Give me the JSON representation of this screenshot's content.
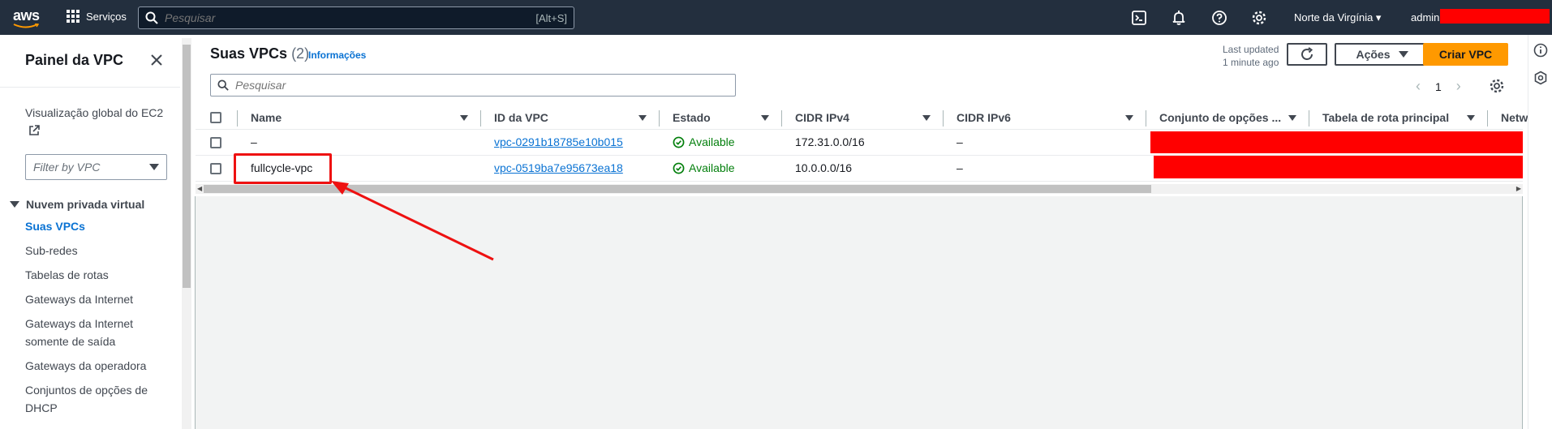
{
  "topbar": {
    "logo_text": "aws",
    "services_label": "Serviços",
    "search_placeholder": "Pesquisar",
    "search_shortcut": "[Alt+S]",
    "region": "Norte da Virgínia ▾",
    "user": "admin"
  },
  "sidebar": {
    "title": "Painel da VPC",
    "global_view": "Visualização global do EC2",
    "filter_placeholder": "Filter by VPC",
    "section": "Nuvem privada virtual",
    "items": [
      {
        "label": "Suas VPCs",
        "active": true
      },
      {
        "label": "Sub-redes"
      },
      {
        "label": "Tabelas de rotas"
      },
      {
        "label": "Gateways da Internet"
      },
      {
        "label": "Gateways da Internet somente de saída"
      },
      {
        "label": "Gateways da operadora"
      },
      {
        "label": "Conjuntos de opções de DHCP"
      }
    ]
  },
  "header": {
    "title": "Suas VPCs",
    "count": "(2)",
    "info": "Informações",
    "last_updated_line1": "Last updated",
    "last_updated_line2": "1 minute ago",
    "actions_label": "Ações",
    "create_label": "Criar VPC"
  },
  "table": {
    "search_placeholder": "Pesquisar",
    "page": "1",
    "columns": [
      "Name",
      "ID da VPC",
      "Estado",
      "CIDR IPv4",
      "CIDR IPv6",
      "Conjunto de opções ...",
      "Tabela de rota principal",
      "Netw"
    ],
    "rows": [
      {
        "name": "–",
        "vpc_id": "vpc-0291b18785e10b015",
        "state": "Available",
        "cidr4": "172.31.0.0/16",
        "cidr6": "–"
      },
      {
        "name": "fullcycle-vpc",
        "vpc_id": "vpc-0519ba7e95673ea18",
        "state": "Available",
        "cidr4": "10.0.0.0/16",
        "cidr6": "–"
      }
    ]
  },
  "colors": {
    "topbar": "#232f3e",
    "link": "#0972d3",
    "primary_button": "#ff9900",
    "status_ok": "#037f0c",
    "annotation": "#ee1111",
    "redaction": "#ff0000"
  },
  "icons": [
    "aws-logo",
    "grid-icon",
    "search-icon",
    "cloudshell-icon",
    "bell-icon",
    "help-icon",
    "gear-icon",
    "close-icon",
    "external-link-icon",
    "refresh-icon",
    "check-circle-icon",
    "info-icon"
  ]
}
